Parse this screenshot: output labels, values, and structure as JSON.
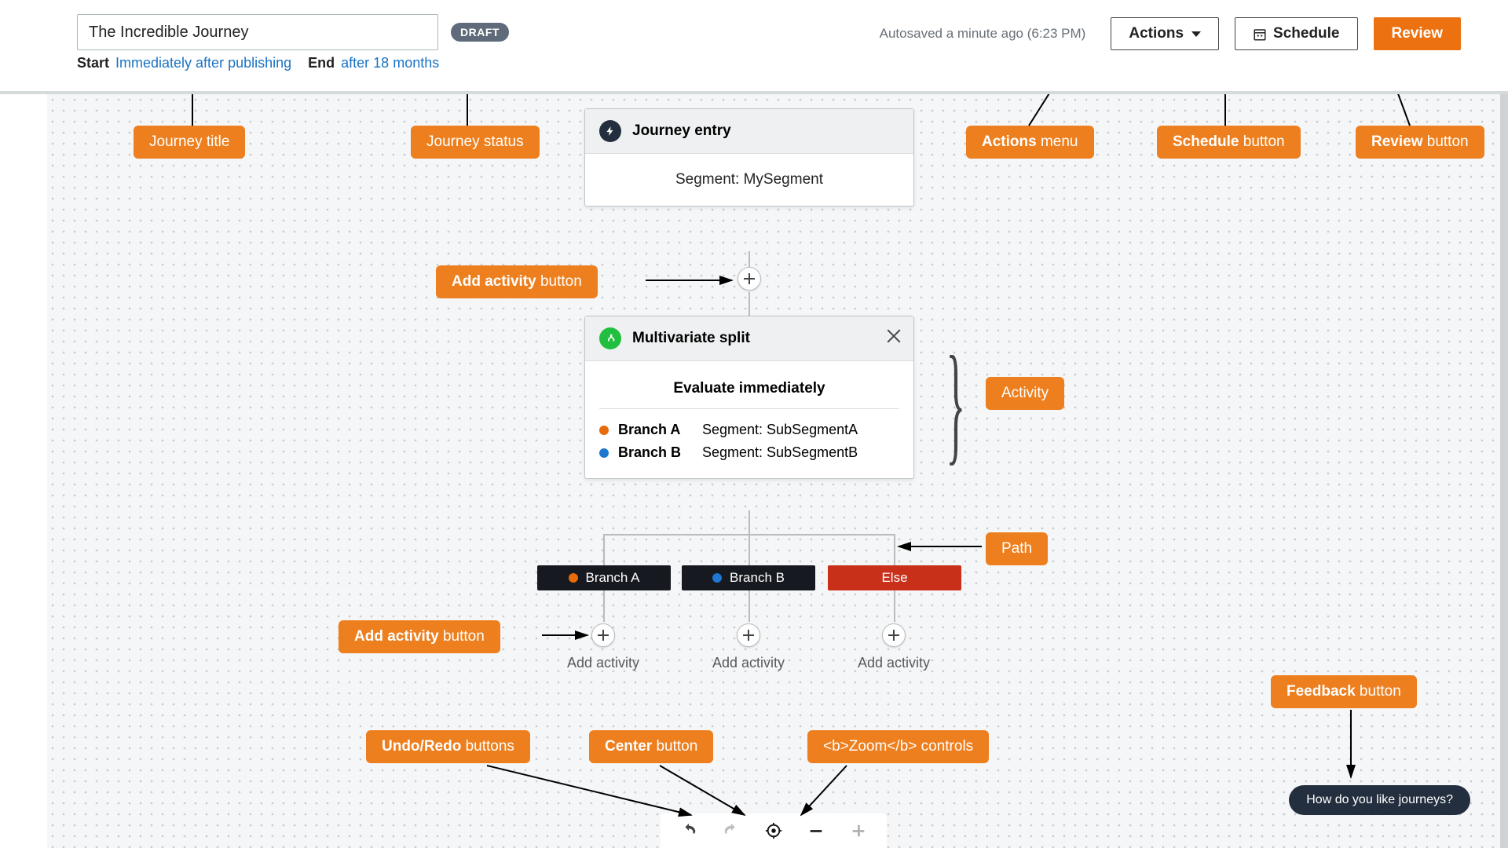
{
  "header": {
    "title": "The Incredible Journey",
    "status": "DRAFT",
    "start_label": "Start",
    "start_value": "Immediately after publishing",
    "end_label": "End",
    "end_value": "after 18 months",
    "autosave": "Autosaved a minute ago (6:23 PM)",
    "actions_label": "Actions",
    "schedule_label": "Schedule",
    "review_label": "Review"
  },
  "entry": {
    "title": "Journey entry",
    "body": "Segment: MySegment"
  },
  "split": {
    "title": "Multivariate split",
    "eval": "Evaluate immediately",
    "branches": [
      {
        "name": "Branch A",
        "desc": "Segment: SubSegmentA",
        "color": "orange"
      },
      {
        "name": "Branch B",
        "desc": "Segment: SubSegmentB",
        "color": "blue"
      }
    ]
  },
  "paths": {
    "a": "Branch A",
    "b": "Branch B",
    "else": "Else",
    "add_label": "Add activity"
  },
  "feedback": "How do you like journeys?",
  "callouts": {
    "title": "Journey title",
    "status": "Journey status",
    "actions": "<b>Actions</b> menu",
    "schedule": "<b>Schedule</b> button",
    "review": "<b>Review</b> button",
    "add1": "<b>Add activity</b> button",
    "activity": "Activity",
    "path": "Path",
    "add2": "<b>Add activity</b> button",
    "feedback": "<b>Feedback</b> button",
    "undo": "<b>Undo/Redo</b> buttons",
    "center": "<b>Center</b> button",
    "zoom": "<b>Zoom</b> controls"
  }
}
